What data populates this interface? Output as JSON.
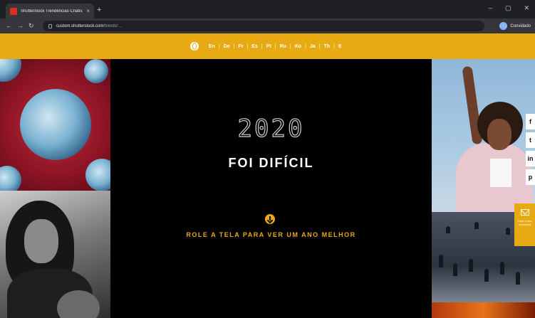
{
  "browser": {
    "tab_title": "Shutterstock Trendências Criativ...",
    "tab_close": "×",
    "new_tab": "+",
    "url_host": "custom.shutterstock.com",
    "url_path": "/trends/…",
    "profile_label": "Convidado"
  },
  "languages": [
    "En",
    "De",
    "Fr",
    "Es",
    "Pt",
    "Ru",
    "Ko",
    "Ja",
    "Th",
    "It"
  ],
  "active_language": "Pt",
  "hero": {
    "year": "2020",
    "headline": "FOI DIFÍCIL",
    "scroll_cta": "ROLE A TELA PARA VER UM ANO MELHOR"
  },
  "social": {
    "buttons": [
      "f",
      "t",
      "in",
      "p"
    ],
    "share_text": "Faça o seu download"
  },
  "colors": {
    "accent": "#e8aa12",
    "background": "#000000"
  }
}
